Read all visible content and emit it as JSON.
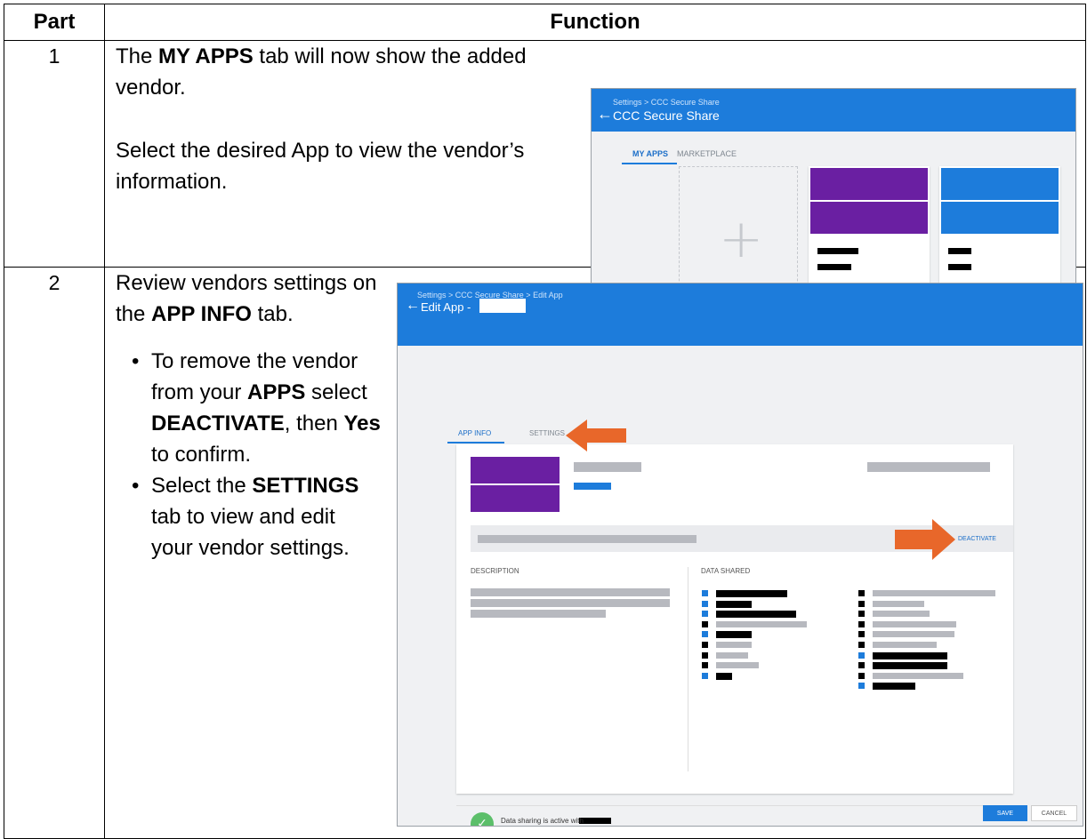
{
  "table": {
    "header_part": "Part",
    "header_function": "Function",
    "rows": [
      {
        "part": "1",
        "text_parts": [
          "The ",
          "MY APPS",
          " tab will now show the added vendor."
        ],
        "text2": "Select the desired App to view the vendor’s information."
      },
      {
        "part": "2",
        "intro": [
          "Review vendors settings on the ",
          "APP INFO",
          " tab."
        ],
        "bullets": [
          {
            "pieces": [
              "To remove the vendor from your ",
              "APPS",
              " select ",
              "DEACTIVATE",
              ", then ",
              "Yes",
              " to confirm."
            ]
          },
          {
            "pieces": [
              "Select the ",
              "SETTINGS",
              " tab to view and edit your vendor settings."
            ]
          }
        ]
      }
    ]
  },
  "screen1": {
    "breadcrumb": "Settings > CCC Secure Share",
    "title": "CCC Secure Share",
    "tabs": [
      "MY APPS",
      "MARKETPLACE"
    ],
    "add_symbol": "+"
  },
  "screen2": {
    "breadcrumb": "Settings > CCC Secure Share > Edit App",
    "title": "Edit App -",
    "tabs": [
      "APP INFO",
      "SETTINGS"
    ],
    "deactivate": "DEACTIVATE",
    "description_label": "DESCRIPTION",
    "data_shared_label": "DATA SHARED",
    "status_text": "Data sharing is active with",
    "save": "SAVE",
    "cancel": "CANCEL"
  },
  "colors": {
    "accent_blue": "#1d7cdb",
    "vendor_purple": "#6a1fa2",
    "arrow_orange": "#e8672a",
    "success_green": "#5cbf6a"
  }
}
